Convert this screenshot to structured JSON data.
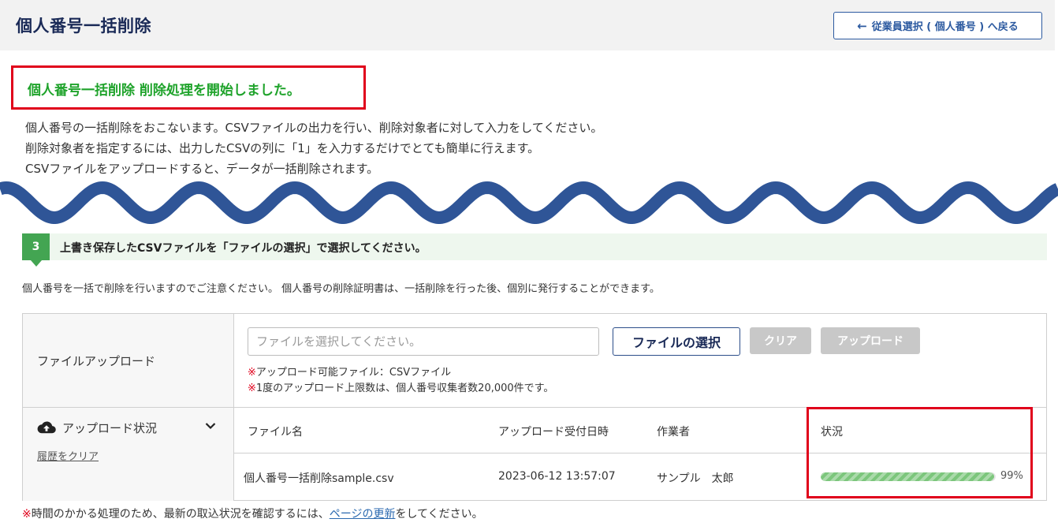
{
  "header": {
    "title": "個人番号一括削除",
    "back_button_label": "従業員選択 ( 個人番号 ) へ戻る"
  },
  "success_message": "個人番号一括削除 削除処理を開始しました。",
  "description": [
    "個人番号の一括削除をおこないます。CSVファイルの出力を行い、削除対象者に対して入力をしてください。",
    "削除対象者を指定するには、出力したCSVの列に「1」を入力するだけでとても簡単に行えます。",
    "CSVファイルをアップロードすると、データが一括削除されます。"
  ],
  "step": {
    "number": "3",
    "text": "上書き保存したCSVファイルを「ファイルの選択」で選択してください。"
  },
  "notice": "個人番号を一括で削除を行いますのでご注意ください。 個人番号の削除証明書は、一括削除を行った後、個別に発行することができます。",
  "upload": {
    "label": "ファイルアップロード",
    "input_placeholder": "ファイルを選択してください。",
    "select_button": "ファイルの選択",
    "clear_button": "クリア",
    "upload_button": "アップロード",
    "note_mark": "※",
    "notes": [
      "アップロード可能ファイル：CSVファイル",
      "1度のアップロード上限数は、個人番号収集者数20,000件です。"
    ]
  },
  "upload_status": {
    "title": "アップロード状況",
    "clear_history": "履歴をクリア",
    "columns": [
      "ファイル名",
      "アップロード受付日時",
      "作業者",
      "状況"
    ],
    "row": {
      "file_name": "個人番号一括削除sample.csv",
      "received_at": "2023-06-12 13:57:07",
      "operator": "サンプル　太郎",
      "progress": 0.99,
      "progress_label": "99%"
    }
  },
  "footer": {
    "mark": "※",
    "text_before": "時間のかかる処理のため、最新の取込状況を確認するには、",
    "link": "ページの更新",
    "text_after": "をしてください。"
  },
  "colors": {
    "title": "#1a2a57",
    "success": "#1fa32b",
    "highlight_border": "#e0001b",
    "wave": "#2f5597",
    "step_badge": "#43a552",
    "step_bg": "#eef7ee",
    "progress_fill": "#7cc67c",
    "link": "#2c6ab0"
  },
  "icons": {
    "back": "arrow-left-icon",
    "cloud": "cloud-upload-icon",
    "chevron": "chevron-down-icon"
  }
}
